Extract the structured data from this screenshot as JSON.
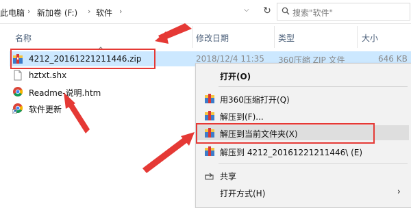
{
  "address": {
    "crumbs": [
      "此电脑",
      "新加卷 (F:)",
      "软件"
    ],
    "search_placeholder": "搜索\"软件\""
  },
  "columns": {
    "name": "名称",
    "modified": "修改日期",
    "type": "类型",
    "size": "大小"
  },
  "files": [
    {
      "name": "4212_20161221211446.zip",
      "icon": "zip-archive-icon",
      "modified": "2018/12/4 11:35",
      "type": "360压缩 ZIP 文件",
      "size": "646 KB"
    },
    {
      "name": "hztxt.shx",
      "icon": "blank-file-icon"
    },
    {
      "name": "Readme-说明.htm",
      "icon": "chrome-html-icon"
    },
    {
      "name": "软件更新",
      "icon": "chrome-shortcut-icon"
    }
  ],
  "context_menu": {
    "open": "打开(O)",
    "open_360": "用360压缩打开(Q)",
    "extract_to": "解压到(F)...",
    "extract_here": "解压到当前文件夹(X)",
    "extract_folder": "解压到 4212_20161221211446\\ (E)",
    "share": "共享",
    "open_with": "打开方式(H)"
  },
  "colors": {
    "selection": "#cce8ff",
    "annotation": "#e53935",
    "menu_bg": "#f2f2f2"
  }
}
